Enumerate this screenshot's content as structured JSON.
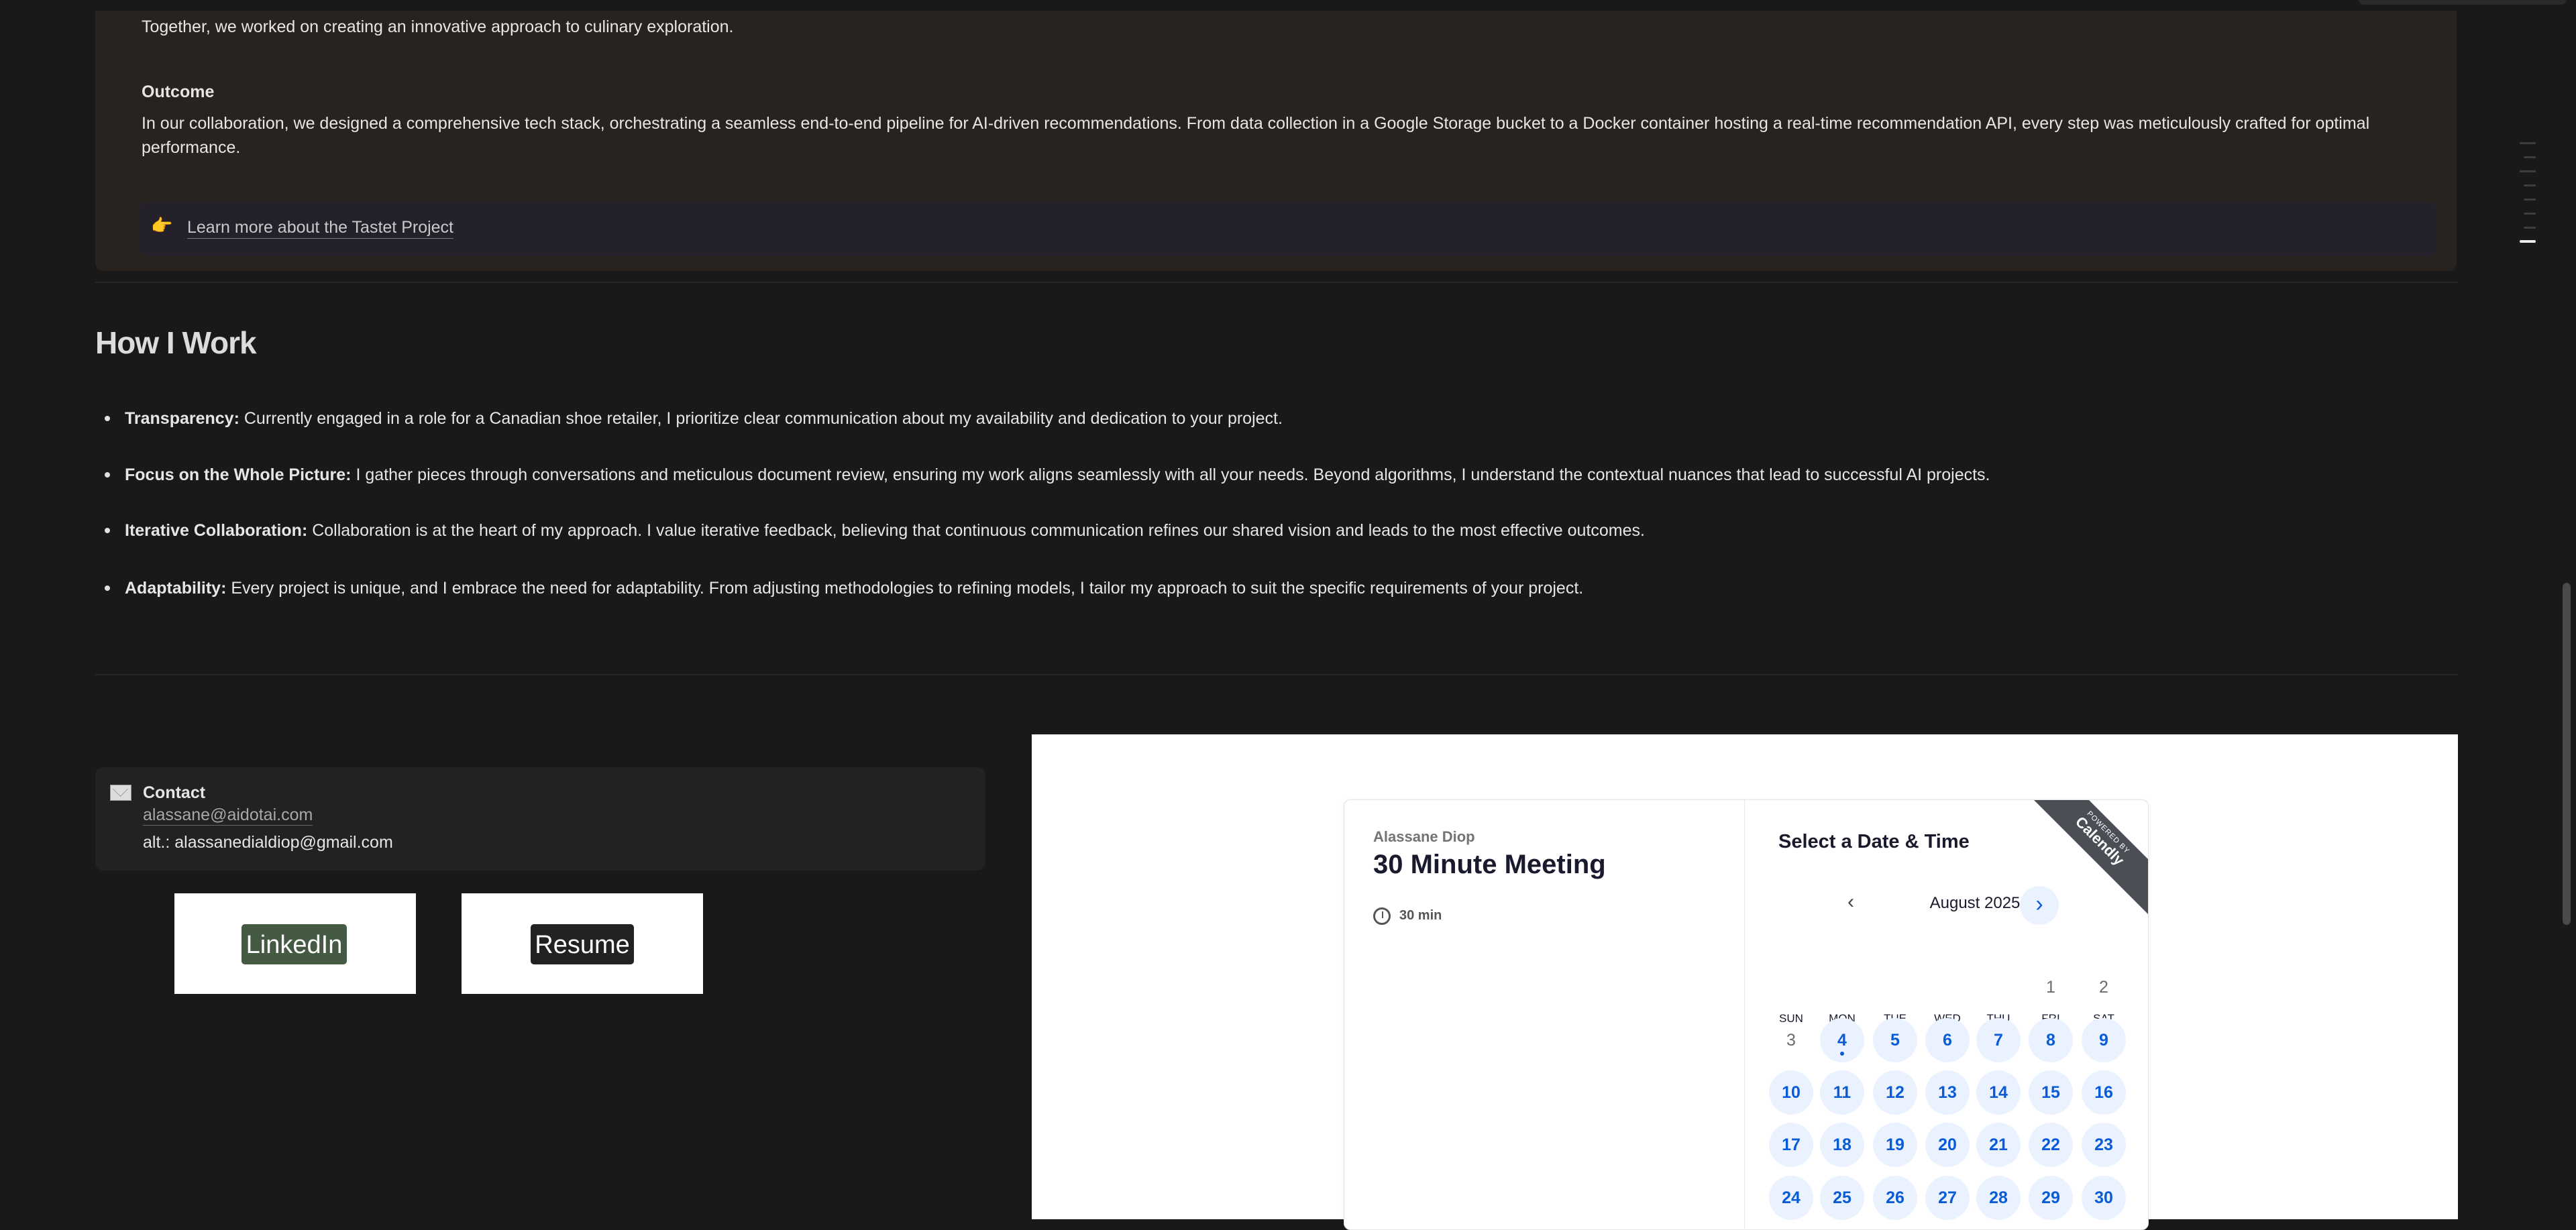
{
  "project": {
    "together_text": "Together, we worked on creating an innovative approach to culinary exploration.",
    "outcome_heading": "Outcome",
    "outcome_line1": "In our collaboration, we designed a comprehensive tech stack, orchestrating a seamless end-to-end pipeline for AI-driven recommendations. From data collection in a Google Storage bucket to a Docker container hosting a real-time recommendation API, every step was meticulously crafted for optimal",
    "outcome_line2": "performance.",
    "link_emoji": "👉",
    "link_label": "Learn more about the Tastet Project"
  },
  "how_i_work": {
    "title": "How I Work",
    "items": [
      {
        "label": "Transparency:",
        "text": " Currently engaged in a role for a Canadian shoe retailer, I prioritize clear communication about my availability and dedication to your project."
      },
      {
        "label": "Focus on the Whole Picture:",
        "text": " I gather pieces through conversations and meticulous document review, ensuring my work aligns seamlessly with all your needs. Beyond algorithms, I understand the contextual nuances that lead to successful AI projects."
      },
      {
        "label": "Iterative Collaboration:",
        "text": " Collaboration is at the heart of my approach. I value iterative feedback, believing that continuous communication refines our shared vision and leads to the most effective outcomes."
      },
      {
        "label": "Adaptability:",
        "text": " Every project is unique, and I embrace the need for adaptability. From adjusting methodologies to refining models, I tailor my approach to suit the specific requirements of your project."
      }
    ]
  },
  "contact": {
    "title": "Contact",
    "email": "alassane@aidotai.com",
    "alt": "alt.: alassanedialdiop@gmail.com",
    "linkedin_label": "LinkedIn",
    "resume_label": "Resume",
    "linkedin_color": "#445a42",
    "resume_color": "#222222"
  },
  "calendly": {
    "host": "Alassane Diop",
    "event": "30 Minute Meeting",
    "duration": "30 min",
    "heading": "Select a Date & Time",
    "month": "August 2025",
    "ribbon_small": "POWERED BY",
    "ribbon_brand": "Calendly",
    "weekdays": [
      "SUN",
      "MON",
      "TUE",
      "WED",
      "THU",
      "FRI",
      "SAT"
    ],
    "first_weekday_index": 5,
    "days_shown": 30,
    "unavailable_days": [
      1,
      2,
      3
    ],
    "today": 4,
    "accent": "#0a5cd6"
  }
}
